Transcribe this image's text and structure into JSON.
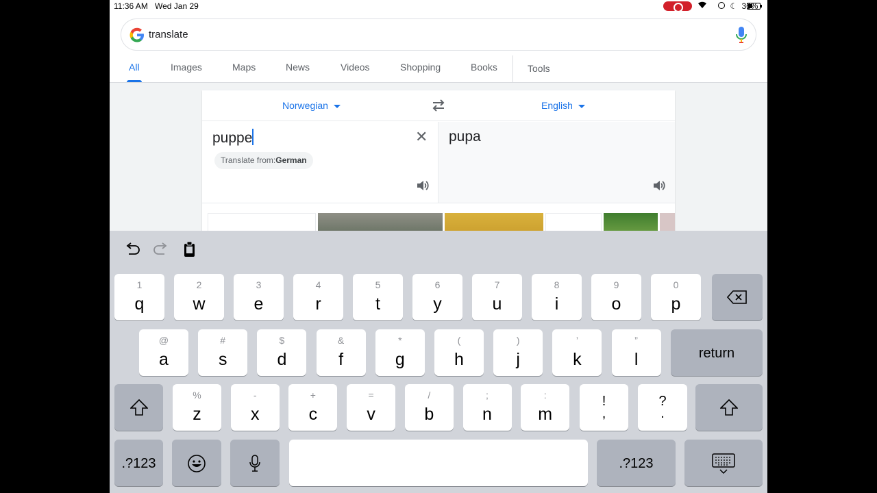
{
  "status_bar": {
    "time": "11:36 AM",
    "date": "Wed Jan 29",
    "battery": "36%"
  },
  "search": {
    "query": "translate"
  },
  "tabs": [
    {
      "label": "All"
    },
    {
      "label": "Images"
    },
    {
      "label": "Maps"
    },
    {
      "label": "News"
    },
    {
      "label": "Videos"
    },
    {
      "label": "Shopping"
    },
    {
      "label": "Books"
    },
    {
      "label": "Tools"
    }
  ],
  "translate": {
    "source_lang": "Norwegian",
    "target_lang": "English",
    "source_text": "puppe",
    "target_text": "pupa",
    "suggest_prefix": "Translate from:",
    "suggest_lang": "German"
  },
  "keyboard": {
    "row1": [
      {
        "alt": "1",
        "main": "q"
      },
      {
        "alt": "2",
        "main": "w"
      },
      {
        "alt": "3",
        "main": "e"
      },
      {
        "alt": "4",
        "main": "r"
      },
      {
        "alt": "5",
        "main": "t"
      },
      {
        "alt": "6",
        "main": "y"
      },
      {
        "alt": "7",
        "main": "u"
      },
      {
        "alt": "8",
        "main": "i"
      },
      {
        "alt": "9",
        "main": "o"
      },
      {
        "alt": "0",
        "main": "p"
      }
    ],
    "row2": [
      {
        "alt": "@",
        "main": "a"
      },
      {
        "alt": "#",
        "main": "s"
      },
      {
        "alt": "$",
        "main": "d"
      },
      {
        "alt": "&",
        "main": "f"
      },
      {
        "alt": "*",
        "main": "g"
      },
      {
        "alt": "(",
        "main": "h"
      },
      {
        "alt": ")",
        "main": "j"
      },
      {
        "alt": "’",
        "main": "k"
      },
      {
        "alt": "”",
        "main": "l"
      }
    ],
    "row3": [
      {
        "alt": "%",
        "main": "z"
      },
      {
        "alt": "-",
        "main": "x"
      },
      {
        "alt": "+",
        "main": "c"
      },
      {
        "alt": "=",
        "main": "v"
      },
      {
        "alt": "/",
        "main": "b"
      },
      {
        "alt": ";",
        "main": "n"
      },
      {
        "alt": ":",
        "main": "m"
      }
    ],
    "punct": [
      {
        "top": "!",
        "bottom": ","
      },
      {
        "top": "?",
        "bottom": "."
      }
    ],
    "return_label": "return",
    "numbers_label": ".?123"
  }
}
